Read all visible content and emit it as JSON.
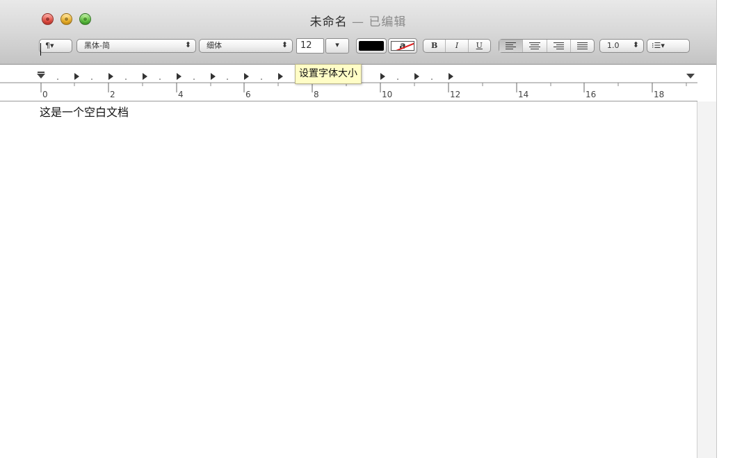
{
  "window": {
    "title": "未命名",
    "title_separator": " — ",
    "edited_label": "已编辑"
  },
  "toolbar": {
    "paragraph_button": "¶▾",
    "font_family": "黑体-简",
    "font_style": "细体",
    "font_size": "12",
    "font_size_arrow": "▾",
    "text_color": "#000000",
    "bg_color_glyph": "a",
    "bold_label": "B",
    "italic_label": "I",
    "underline_label": "U",
    "alignment_selected": "left",
    "line_spacing": "1.0",
    "list_button": "⁝☰▾",
    "stepper_arrows": "⌃⌄"
  },
  "ruler": {
    "numbers": [
      "0",
      "2",
      "4",
      "6",
      "8",
      "10",
      "12",
      "14",
      "16",
      "18"
    ]
  },
  "tooltip": {
    "text": "设置字体大小"
  },
  "document": {
    "body_text": "这是一个空白文档"
  },
  "colors": {
    "tooltip_bg": "#fffdc6",
    "close": "#e8473b",
    "minimize": "#f3b320",
    "zoom": "#57c13a"
  }
}
